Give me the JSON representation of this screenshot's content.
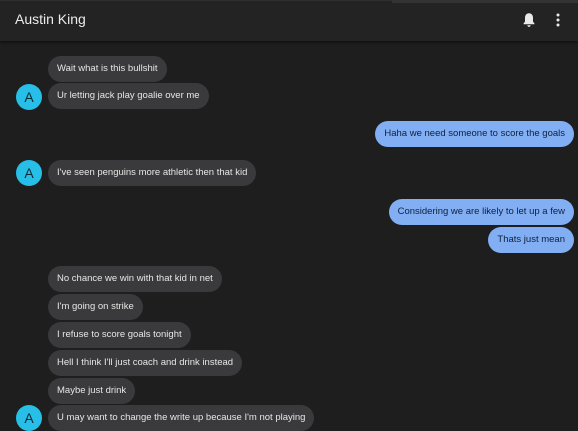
{
  "header": {
    "contact_name": "Austin King",
    "bell_icon": "bell-icon",
    "menu_icon": "more-vert-icon"
  },
  "colors": {
    "background": "#1e1e1e",
    "incoming_bubble": "#3a3a3c",
    "outgoing_bubble": "#82aef3",
    "avatar": "#27bfe8"
  },
  "avatar_letter": "A",
  "messages": [
    {
      "from": "contact",
      "text": "Wait what is this bullshit"
    },
    {
      "from": "contact",
      "text": "Ur letting jack play goalie over me"
    },
    {
      "from": "me",
      "text": "Haha we need someone to score the goals"
    },
    {
      "from": "contact",
      "text": "I've seen penguins more athletic then that kid"
    },
    {
      "from": "me",
      "text": "Considering we are likely to let up a few"
    },
    {
      "from": "me",
      "text": "Thats just mean"
    },
    {
      "from": "contact",
      "text": "No chance we win with that kid in net"
    },
    {
      "from": "contact",
      "text": "I'm going on strike"
    },
    {
      "from": "contact",
      "text": "I refuse to score goals tonight"
    },
    {
      "from": "contact",
      "text": "Hell I think I'll just coach and drink instead"
    },
    {
      "from": "contact",
      "text": "Maybe just drink"
    },
    {
      "from": "contact",
      "text": "U may want to change the write up because I'm not playing"
    }
  ]
}
